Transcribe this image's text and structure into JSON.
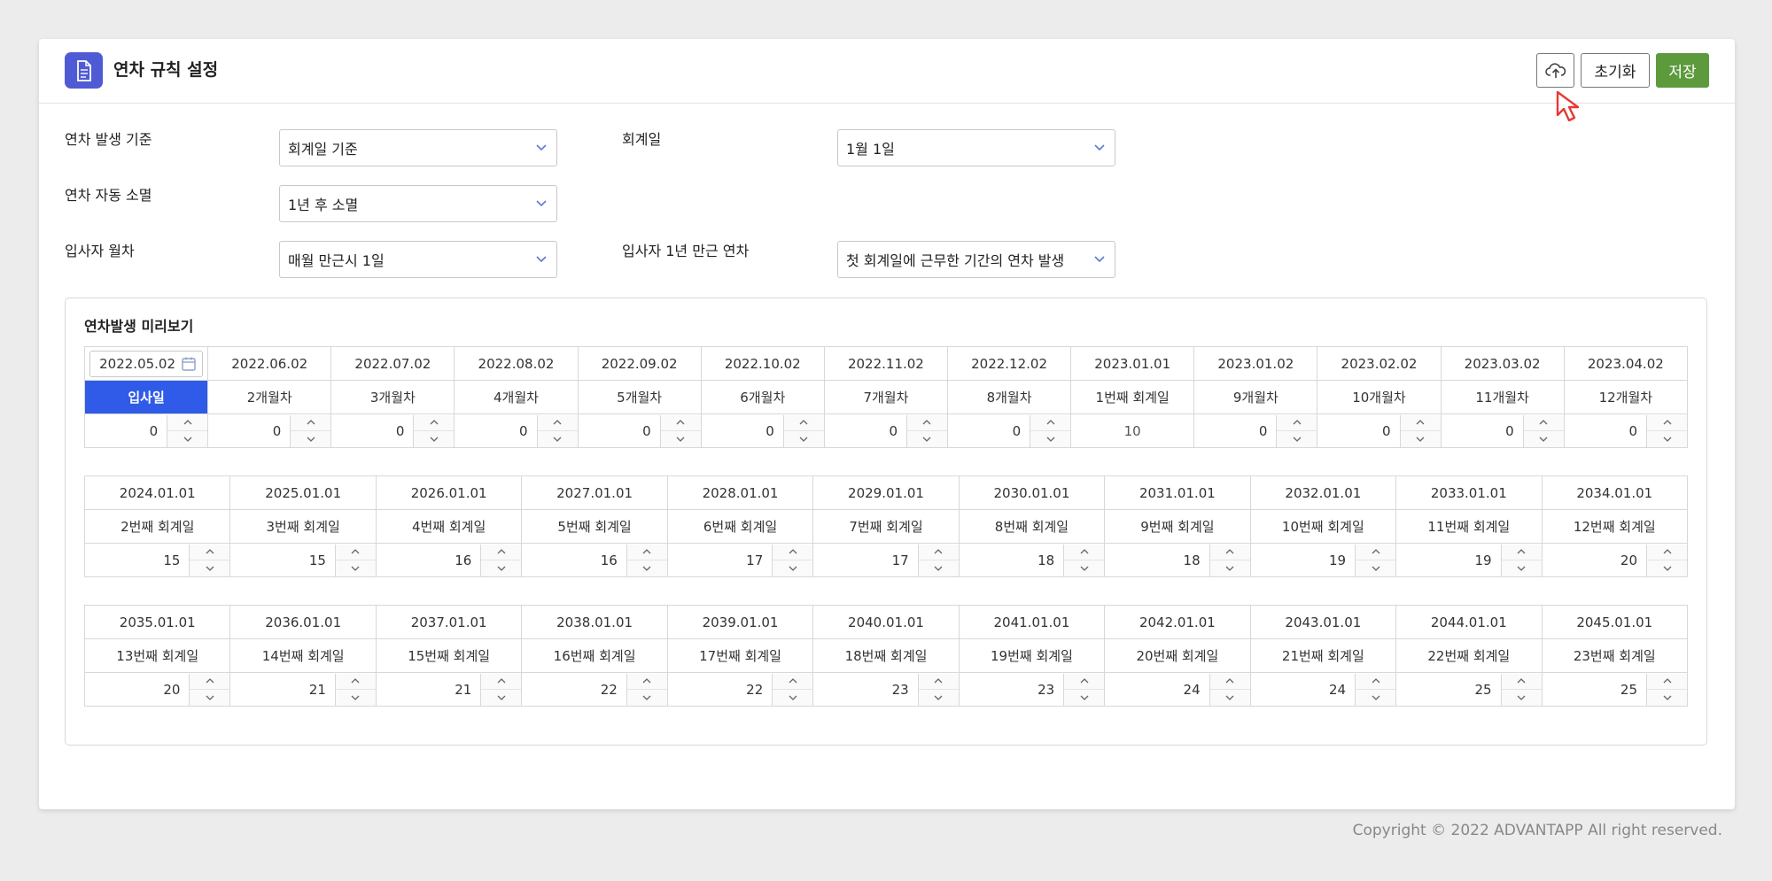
{
  "header": {
    "title": "연차 규칙 설정",
    "reset_label": "초기화",
    "save_label": "저장",
    "upload_icon": "cloud-upload-icon",
    "title_icon": "document-icon"
  },
  "form": {
    "accrual_basis": {
      "label": "연차 발생 기준",
      "value": "회계일 기준"
    },
    "fiscal_date": {
      "label": "회계일",
      "value": "1월 1일"
    },
    "auto_expire": {
      "label": "연차 자동 소멸",
      "value": "1년 후 소멸"
    },
    "monthly_leave": {
      "label": "입사자 월차",
      "value": "매월 만근시 1일"
    },
    "first_year_leave": {
      "label": "입사자 1년 만근 연차",
      "value": "첫 회계일에 근무한 기간의 연차 발생"
    }
  },
  "preview": {
    "title": "연차발생 미리보기",
    "hire_date": "2022.05.02",
    "rows": [
      {
        "dates": [
          "2022.05.02",
          "2022.06.02",
          "2022.07.02",
          "2022.08.02",
          "2022.09.02",
          "2022.10.02",
          "2022.11.02",
          "2022.12.02",
          "2023.01.01",
          "2023.01.02",
          "2023.02.02",
          "2023.03.02",
          "2023.04.02"
        ],
        "labels": [
          "입사일",
          "2개월차",
          "3개월차",
          "4개월차",
          "5개월차",
          "6개월차",
          "7개월차",
          "8개월차",
          "1번째 회계일",
          "9개월차",
          "10개월차",
          "11개월차",
          "12개월차"
        ],
        "values": [
          "0",
          "0",
          "0",
          "0",
          "0",
          "0",
          "0",
          "0",
          "10",
          "0",
          "0",
          "0",
          "0"
        ]
      },
      {
        "dates": [
          "2024.01.01",
          "2025.01.01",
          "2026.01.01",
          "2027.01.01",
          "2028.01.01",
          "2029.01.01",
          "2030.01.01",
          "2031.01.01",
          "2032.01.01",
          "2033.01.01",
          "2034.01.01"
        ],
        "labels": [
          "2번째 회계일",
          "3번째 회계일",
          "4번째 회계일",
          "5번째 회계일",
          "6번째 회계일",
          "7번째 회계일",
          "8번째 회계일",
          "9번째 회계일",
          "10번째 회계일",
          "11번째 회계일",
          "12번째 회계일"
        ],
        "values": [
          "15",
          "15",
          "16",
          "16",
          "17",
          "17",
          "18",
          "18",
          "19",
          "19",
          "20"
        ]
      },
      {
        "dates": [
          "2035.01.01",
          "2036.01.01",
          "2037.01.01",
          "2038.01.01",
          "2039.01.01",
          "2040.01.01",
          "2041.01.01",
          "2042.01.01",
          "2043.01.01",
          "2044.01.01",
          "2045.01.01"
        ],
        "labels": [
          "13번째 회계일",
          "14번째 회계일",
          "15번째 회계일",
          "16번째 회계일",
          "17번째 회계일",
          "18번째 회계일",
          "19번째 회계일",
          "20번째 회계일",
          "21번째 회계일",
          "22번째 회계일",
          "23번째 회계일"
        ],
        "values": [
          "20",
          "21",
          "21",
          "22",
          "22",
          "23",
          "23",
          "24",
          "24",
          "25",
          "25"
        ]
      }
    ]
  },
  "footer": {
    "copyright": "Copyright © 2022 ADVANTAPP All right reserved."
  },
  "colors": {
    "accent": "#2f5be8",
    "save": "#5c9a3c",
    "title_icon_bg": "#4f5bd5"
  }
}
